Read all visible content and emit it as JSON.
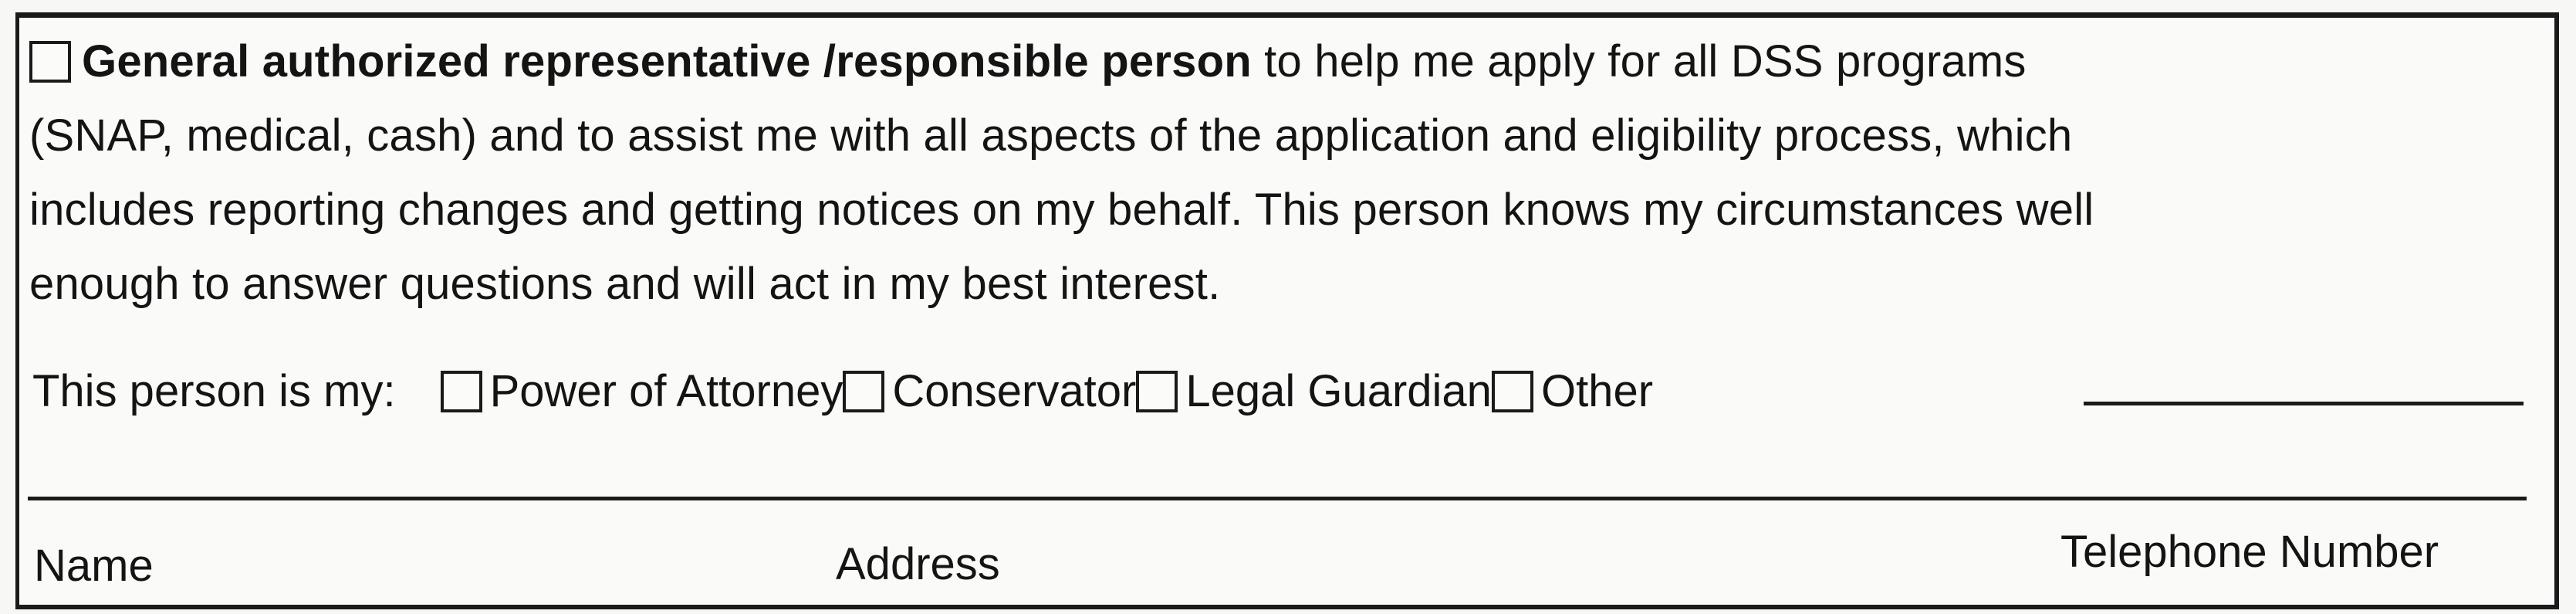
{
  "representative": {
    "checkbox_checked": false,
    "title": "General authorized representative /responsible person",
    "text_line1": " to help me apply for all DSS programs",
    "text_line2": "(SNAP, medical, cash) and to assist me with all aspects of the application and eligibility process, which",
    "text_line3": "includes reporting changes and getting notices on my behalf.  This person knows my circumstances well",
    "text_line4": "enough to answer questions and will act in my best interest."
  },
  "relationship": {
    "lead_label": "This person is my:",
    "options": [
      {
        "label": "Power of Attorney",
        "checked": false
      },
      {
        "label": "Conservator",
        "checked": false
      },
      {
        "label": "Legal Guardian",
        "checked": false
      },
      {
        "label": "Other",
        "checked": false
      }
    ],
    "other_value": ""
  },
  "signature_fields": {
    "name_label": "Name",
    "address_label": "Address",
    "phone_label": "Telephone Number",
    "value": ""
  }
}
